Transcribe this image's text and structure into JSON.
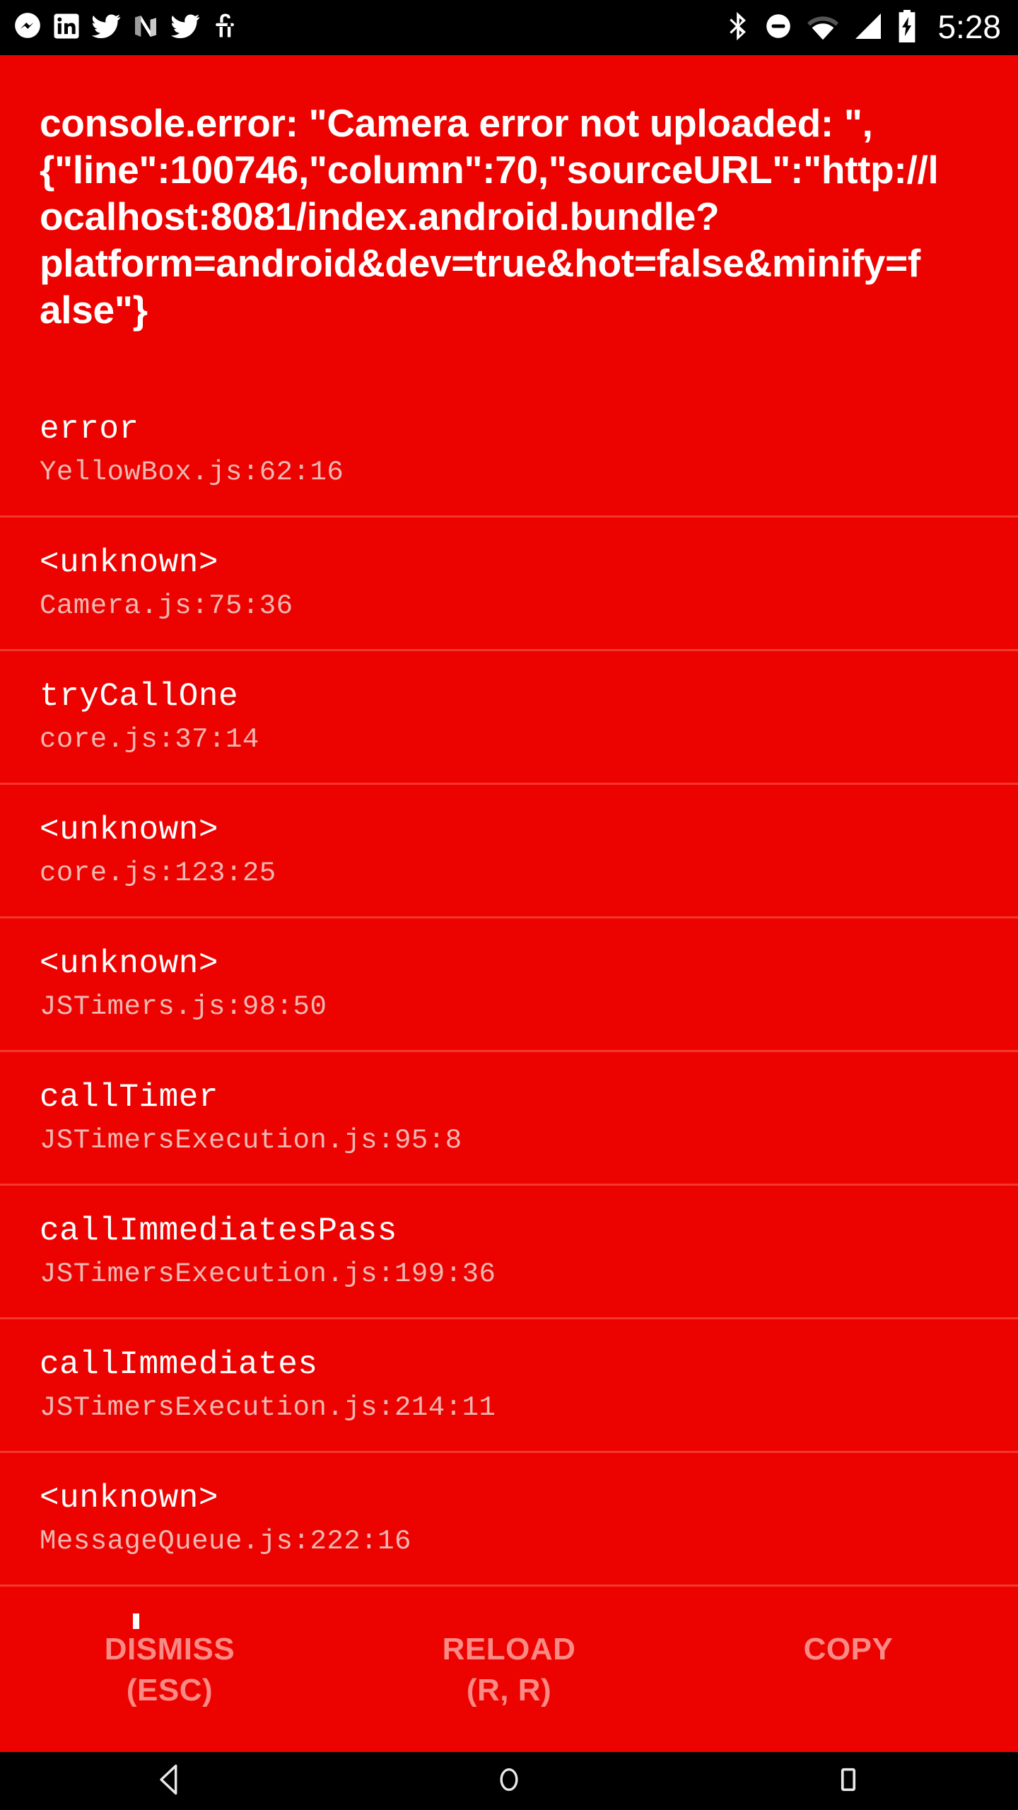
{
  "status_bar": {
    "left_icons": [
      {
        "name": "messenger-icon",
        "label": "Messenger"
      },
      {
        "name": "linkedin-icon",
        "label": "LinkedIn"
      },
      {
        "name": "twitter-icon",
        "label": "Twitter"
      },
      {
        "name": "nova-n-icon",
        "label": "N"
      },
      {
        "name": "twitter-icon-2",
        "label": "Twitter"
      },
      {
        "name": "project-fi-icon",
        "label": "fi"
      }
    ],
    "right_icons": [
      {
        "name": "bluetooth-icon",
        "label": "Bluetooth"
      },
      {
        "name": "do-not-disturb-icon",
        "label": "Do Not Disturb"
      },
      {
        "name": "wifi-icon",
        "label": "Wi-Fi"
      },
      {
        "name": "cellular-signal-icon",
        "label": "Cellular signal"
      },
      {
        "name": "battery-charging-icon",
        "label": "Battery charging"
      }
    ],
    "clock": "5:28"
  },
  "redbox": {
    "background_color": "#EC0300",
    "divider_color": "#F43830",
    "title_color": "#FFFFFF",
    "frame_location_color": "#F0B7B3",
    "button_color": "#F98A85",
    "title": "console.error: \"Camera error not uploaded: \", {\"line\":100746,\"column\":70,\"sourceURL\":\"http://localhost:8081/index.android.bundle?platform=android&dev=true&hot=false&minify=false\"}",
    "stack": [
      {
        "fn": "error",
        "loc": "YellowBox.js:62:16"
      },
      {
        "fn": "<unknown>",
        "loc": "Camera.js:75:36"
      },
      {
        "fn": "tryCallOne",
        "loc": "core.js:37:14"
      },
      {
        "fn": "<unknown>",
        "loc": "core.js:123:25"
      },
      {
        "fn": "<unknown>",
        "loc": "JSTimers.js:98:50"
      },
      {
        "fn": "callTimer",
        "loc": "JSTimersExecution.js:95:8"
      },
      {
        "fn": "callImmediatesPass",
        "loc": "JSTimersExecution.js:199:36"
      },
      {
        "fn": "callImmediates",
        "loc": "JSTimersExecution.js:214:11"
      },
      {
        "fn": "<unknown>",
        "loc": "MessageQueue.js:222:16"
      }
    ],
    "actions": [
      {
        "name": "dismiss-button",
        "label": "DISMISS",
        "shortcut": "(ESC)"
      },
      {
        "name": "reload-button",
        "label": "RELOAD",
        "shortcut": "(R, R)"
      },
      {
        "name": "copy-button",
        "label": "COPY",
        "shortcut": ""
      }
    ]
  },
  "nav_bar": {
    "buttons": [
      {
        "name": "nav-back-button",
        "label": "Back"
      },
      {
        "name": "nav-home-button",
        "label": "Home"
      },
      {
        "name": "nav-recents-button",
        "label": "Recents"
      }
    ]
  }
}
